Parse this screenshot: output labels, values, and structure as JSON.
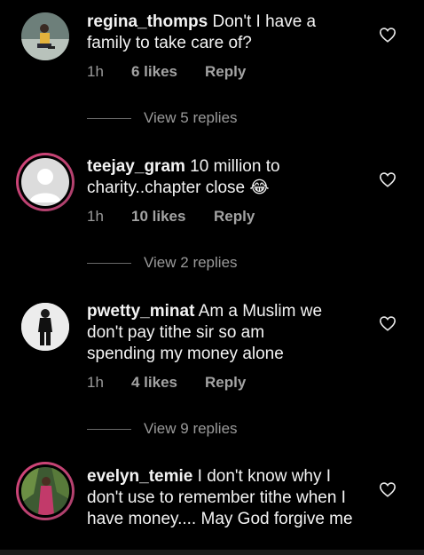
{
  "comments": [
    {
      "username": "regina_thomps",
      "text": " Don't I have a family to take care of?",
      "time": "1h",
      "likes": "6 likes",
      "reply": "Reply",
      "view_replies": "View 5 replies"
    },
    {
      "username": "teejay_gram",
      "text": " 10 million to charity..chapter close 😂",
      "time": "1h",
      "likes": "10 likes",
      "reply": "Reply",
      "view_replies": "View 2 replies"
    },
    {
      "username": "pwetty_minat",
      "text": " Am a Muslim we don't pay tithe sir so am spending my money alone",
      "time": "1h",
      "likes": "4 likes",
      "reply": "Reply",
      "view_replies": "View 9 replies"
    },
    {
      "username": "evelyn_temie",
      "text": " I don't know why I don't use to remember tithe when I have money.... May God forgive me"
    }
  ],
  "colors": {
    "background": "#000000",
    "text": "#f3f3f3",
    "muted": "#9a9a9a",
    "story_ring": "#d6457a"
  },
  "icons": {
    "like": "heart-outline-icon"
  }
}
